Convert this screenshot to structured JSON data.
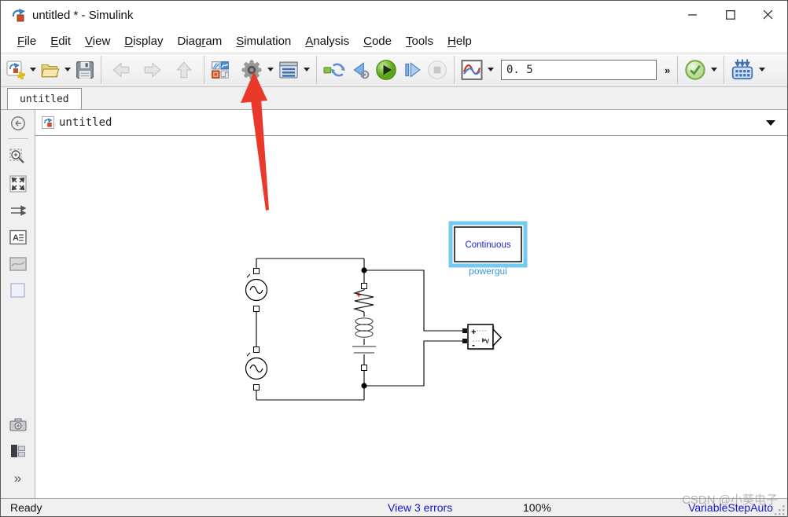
{
  "window": {
    "title": "untitled * - Simulink"
  },
  "title_bar": {
    "icons": [
      "simulink-logo-icon",
      "minimize-icon",
      "maximize-icon",
      "close-icon"
    ]
  },
  "menu": {
    "items": [
      {
        "label": "File",
        "pre": "",
        "mn": "F",
        "post": "ile"
      },
      {
        "label": "Edit",
        "pre": "",
        "mn": "E",
        "post": "dit"
      },
      {
        "label": "View",
        "pre": "",
        "mn": "V",
        "post": "iew"
      },
      {
        "label": "Display",
        "pre": "",
        "mn": "D",
        "post": "isplay"
      },
      {
        "label": "Diagram",
        "pre": "Diag",
        "mn": "r",
        "post": "am"
      },
      {
        "label": "Simulation",
        "pre": "",
        "mn": "S",
        "post": "imulation"
      },
      {
        "label": "Analysis",
        "pre": "",
        "mn": "A",
        "post": "nalysis"
      },
      {
        "label": "Code",
        "pre": "",
        "mn": "C",
        "post": "ode"
      },
      {
        "label": "Tools",
        "pre": "",
        "mn": "T",
        "post": "ools"
      },
      {
        "label": "Help",
        "pre": "",
        "mn": "H",
        "post": "elp"
      }
    ]
  },
  "toolbar": {
    "stop_time": "0. 5",
    "overflow_label": "»",
    "icons": [
      "new-model-icon",
      "open-icon",
      "save-icon",
      "back-icon",
      "forward-icon",
      "up-icon",
      "library-browser-icon",
      "model-settings-gear-icon",
      "model-explorer-icon",
      "refresh-icon",
      "step-back-icon",
      "run-icon",
      "step-forward-icon",
      "stop-icon",
      "simulation-display-icon",
      "model-advisor-check-icon",
      "data-inspector-icon"
    ]
  },
  "tabs": {
    "active": "untitled"
  },
  "breadcrumb": {
    "path": "untitled"
  },
  "palette": {
    "icons": [
      "hide-browser-back-icon",
      "zoom-region-icon",
      "fit-to-view-icon",
      "route-arrows-icon",
      "annotation-icon",
      "image-icon",
      "area-box-icon",
      "camera-icon",
      "model-browser-icon",
      "expand-chevron"
    ],
    "expand_label": "»"
  },
  "canvas": {
    "powergui": {
      "text": "Continuous",
      "label": "powergui",
      "selected": true
    },
    "voltage_measurement": {
      "plus": "+",
      "minus": "-",
      "v_label": "v"
    },
    "resistor_polarity": "+",
    "blocks": [
      "ac-voltage-source-1",
      "ac-voltage-source-2",
      "series-rlc-branch",
      "voltage-measurement",
      "powergui"
    ]
  },
  "annotation_arrow": {
    "target": "model-settings-gear-icon",
    "color": "#e8392a"
  },
  "status_bar": {
    "ready": "Ready",
    "errors_link": "View 3 errors",
    "zoom": "100%",
    "solver": "VariableStepAuto",
    "watermark": "CSDN @小葵电子"
  },
  "colors": {
    "selection_highlight": "#74c9f2",
    "powergui_text": "#2222cc",
    "powergui_label": "#2e9bd6",
    "link_blue": "#1414c8",
    "arrow_red": "#e8392a",
    "run_green": "#6fbf2a",
    "resistor_plus_red": "#dd1111"
  }
}
